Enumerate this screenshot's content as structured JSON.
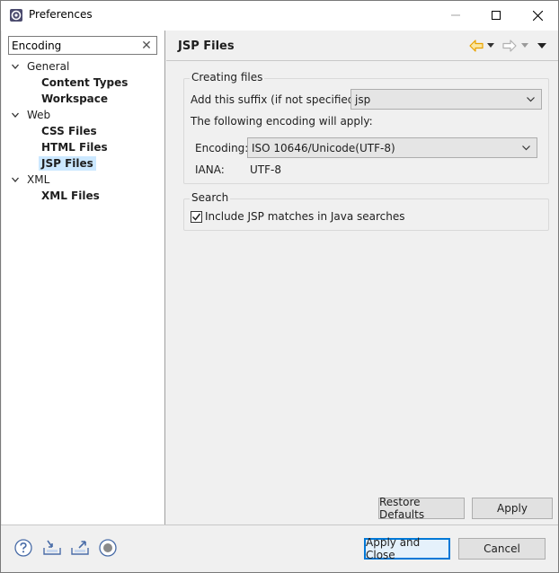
{
  "window": {
    "title": "Preferences",
    "icon": "eclipse-gear-icon"
  },
  "titlebar_buttons": {
    "minimize": "—",
    "maximize": "☐",
    "close": "✕"
  },
  "filter": {
    "value": "Encoding",
    "clear_icon": "✕"
  },
  "tree": [
    {
      "label": "General",
      "level": 0,
      "expanded": true
    },
    {
      "label": "Content Types",
      "level": 1
    },
    {
      "label": "Workspace",
      "level": 1
    },
    {
      "label": "Web",
      "level": 0,
      "expanded": true
    },
    {
      "label": "CSS Files",
      "level": 1
    },
    {
      "label": "HTML Files",
      "level": 1
    },
    {
      "label": "JSP Files",
      "level": 1,
      "selected": true
    },
    {
      "label": "XML",
      "level": 0,
      "expanded": true
    },
    {
      "label": "XML Files",
      "level": 1
    }
  ],
  "page": {
    "title": "JSP Files",
    "creating_group": {
      "title": "Creating files",
      "suffix_label": "Add this suffix (if not specified):",
      "suffix_value": "jsp",
      "encoding_intro": "The following encoding will apply:",
      "encoding_label": "Encoding:",
      "encoding_value": "ISO 10646/Unicode(UTF-8)",
      "iana_label": "IANA:",
      "iana_value": "UTF-8"
    },
    "search_group": {
      "title": "Search",
      "checkbox_label": "Include JSP matches in Java searches",
      "checked": true
    },
    "restore_defaults": "Restore Defaults",
    "apply": "Apply"
  },
  "bottom": {
    "apply_close": "Apply and Close",
    "cancel": "Cancel",
    "icons": [
      "help-icon",
      "import-icon",
      "export-icon",
      "record-icon"
    ]
  },
  "colors": {
    "accent": "#0078d7",
    "selection": "#cce8ff",
    "nav_back": "#e8a200",
    "nav_disabled": "#b0b0b0"
  }
}
